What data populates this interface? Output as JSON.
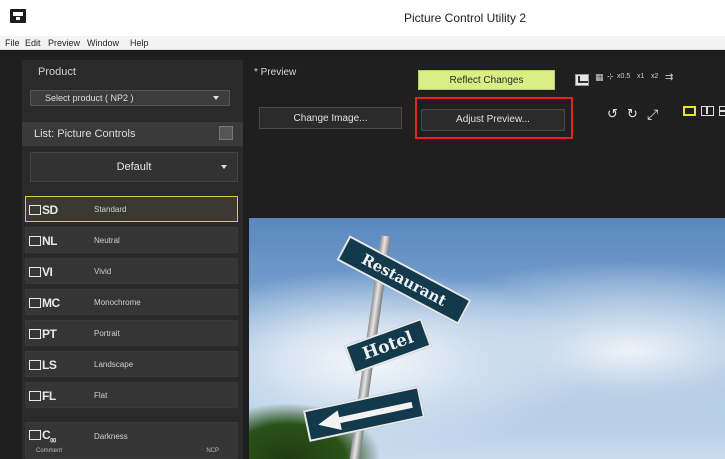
{
  "window": {
    "title": "Picture Control Utility 2",
    "app_icon": "app-logo-icon"
  },
  "menu": [
    "File",
    "Edit",
    "Preview",
    "Window",
    "Help"
  ],
  "left_panel": {
    "product_label": "Product",
    "product_select": "Select product ( NP2 )",
    "list_label": "List: Picture Controls",
    "default_select": "Default",
    "items": [
      {
        "code": "SD",
        "name": "Standard"
      },
      {
        "code": "NL",
        "name": "Neutral"
      },
      {
        "code": "VI",
        "name": "Vivid"
      },
      {
        "code": "MC",
        "name": "Monochrome"
      },
      {
        "code": "PT",
        "name": "Portrait"
      },
      {
        "code": "LS",
        "name": "Landscape"
      },
      {
        "code": "FL",
        "name": "Flat"
      },
      {
        "code": "C",
        "code_sub": "00",
        "name": "Darkness",
        "sub_label": "Comment",
        "badge": "NCP"
      }
    ]
  },
  "preview": {
    "label": "* Preview",
    "reflect_changes": "Reflect Changes",
    "change_image": "Change Image...",
    "adjust_preview": "Adjust Preview...",
    "zoom_options": [
      "x0.5",
      "x1",
      "x2"
    ],
    "image_signs": {
      "restaurant": "Restaurant",
      "hotel": "Hotel"
    }
  },
  "colors": {
    "reflect_button": "#d9ee84",
    "highlight": "#e2261e",
    "selected_border": "#d8cf35"
  }
}
